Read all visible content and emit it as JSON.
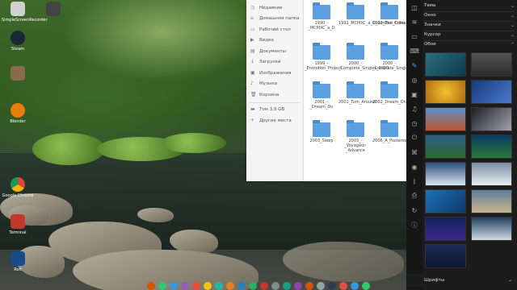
{
  "desktop": {
    "icons": [
      {
        "label": "SimpleScreenRecorder",
        "color": "#d0d0d0"
      },
      {
        "label": "",
        "color": "#444444"
      },
      {
        "label": "Steam",
        "color": "#1b2838"
      },
      {
        "label": "Blender",
        "color": "#e87d0d"
      },
      {
        "label": "Google Chrome",
        "color": "#db4437"
      },
      {
        "label": "Terminal",
        "color": "#c0392b"
      },
      {
        "label": "Rofi",
        "color": "#1a4a8a"
      }
    ]
  },
  "file_manager": {
    "sidebar": [
      {
        "icon": "clock-icon",
        "label": "Недавние"
      },
      {
        "icon": "home-icon",
        "label": "Домашняя папка"
      },
      {
        "icon": "desktop-icon",
        "label": "Рабочий стол"
      },
      {
        "icon": "video-icon",
        "label": "Видео"
      },
      {
        "icon": "document-icon",
        "label": "Документы"
      },
      {
        "icon": "download-icon",
        "label": "Загрузки"
      },
      {
        "icon": "image-icon",
        "label": "Изображения"
      },
      {
        "icon": "music-icon",
        "label": "Музыка"
      },
      {
        "icon": "trash-icon",
        "label": "Корзина"
      }
    ],
    "drives": [
      {
        "icon": "drive-icon",
        "label": "Том 3,9 GB"
      },
      {
        "icon": "plus-icon",
        "label": "Другие места"
      }
    ],
    "folders": [
      "1990_-_MCMXC_a_D",
      "1991_MCMXC_a_D_Limited_Edition",
      "1992_The_Cross_Of_Changes",
      "1999_-_Enmotion_Project",
      "2000_-_Complete_Singles_1990...",
      "2000_-_Complete_Singles_1990...",
      "2001_-_Dream_On",
      "2001_Turn_Around",
      "2002_Dream_On",
      "2003_Sleep",
      "2003_-_Voyageur-_Advance",
      "2006_A_Posteriori"
    ]
  },
  "settings_panel": {
    "rows": [
      {
        "label": "Тема",
        "chev": "⌄"
      },
      {
        "label": "Окно",
        "chev": "⌄"
      },
      {
        "label": "Значки",
        "chev": "⌄"
      },
      {
        "label": "Курсор",
        "chev": "⌄"
      },
      {
        "label": "Обои",
        "chev": "⌃"
      }
    ],
    "fonts_label": "Шрифты",
    "fonts_chev": "⌄",
    "wallpapers": [
      {
        "color": "#2a6f82"
      },
      {
        "color": "#3a3a3a"
      },
      {
        "color": "#d99a1a"
      },
      {
        "color": "#1a3a7a"
      },
      {
        "color": "#5b8fd0"
      },
      {
        "color": "#1f1f24"
      },
      {
        "color": "#2f5f8a"
      },
      {
        "color": "#0a3a60"
      },
      {
        "color": "#2b4f7a"
      },
      {
        "color": "#7a8fa6"
      },
      {
        "color": "#1f6fb8"
      },
      {
        "color": "#5c7f9f"
      },
      {
        "color": "#12205a"
      },
      {
        "color": "#1f4060"
      },
      {
        "color": "#1b2c55"
      }
    ],
    "side_icons": [
      "network-icon",
      "brush-icon",
      "globe-icon",
      "display-icon",
      "sound-icon",
      "clock-icon",
      "power-icon",
      "tag-icon",
      "mouse-icon",
      "keyboard-icon",
      "bluetooth-icon",
      "printer-icon",
      "update-icon",
      "info-icon"
    ]
  },
  "dock": {
    "items": [
      "#d35400",
      "#2ecc71",
      "#3498db",
      "#9b59b6",
      "#e74c3c",
      "#f1c40f",
      "#1abc9c",
      "#e67e22",
      "#2980b9",
      "#27ae60",
      "#c0392b",
      "#7f8c8d",
      "#16a085",
      "#8e44ad",
      "#d35400",
      "#95a5a6",
      "#2c3e50",
      "#e74c3c",
      "#3498db",
      "#2ecc71"
    ]
  }
}
